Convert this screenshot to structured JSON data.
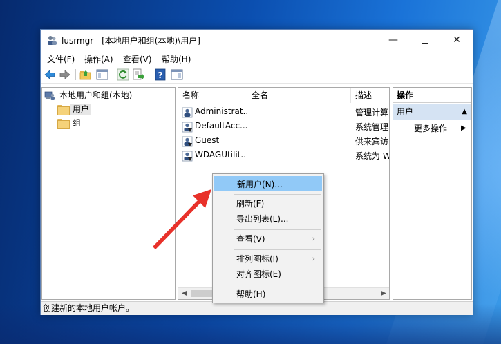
{
  "window": {
    "title": "lusrmgr - [本地用户和组(本地)\\用户]",
    "minimize_glyph": "—",
    "close_glyph": "✕"
  },
  "menubar": {
    "items": [
      "文件(F)",
      "操作(A)",
      "查看(V)",
      "帮助(H)"
    ]
  },
  "toolbar": {
    "icons": [
      "back-arrow-icon",
      "forward-arrow-icon",
      "up-folder-icon",
      "show-hide-tree-icon",
      "refresh-icon",
      "export-list-icon",
      "help-icon",
      "show-hide-action-pane-icon"
    ]
  },
  "tree": {
    "root": "本地用户和组(本地)",
    "items": [
      "用户",
      "组"
    ],
    "selected": "用户"
  },
  "list": {
    "columns": [
      "名称",
      "全名",
      "描述"
    ],
    "rows": [
      {
        "name": "Administrat...",
        "fullname": "",
        "desc": "管理计算"
      },
      {
        "name": "DefaultAcc...",
        "fullname": "",
        "desc": "系统管理"
      },
      {
        "name": "Guest",
        "fullname": "",
        "desc": "供来宾访"
      },
      {
        "name": "WDAGUtilit...",
        "fullname": "",
        "desc": "系统为 W"
      }
    ]
  },
  "actions": {
    "header": "操作",
    "section": "用户",
    "item": "更多操作"
  },
  "status": {
    "text": "创建新的本地用户帐户。"
  },
  "context_menu": {
    "items": [
      "新用户(N)...",
      "刷新(F)",
      "导出列表(L)...",
      "查看(V)",
      "排列图标(I)",
      "对齐图标(E)",
      "帮助(H)"
    ],
    "highlighted": "新用户(N)..."
  },
  "colors": {
    "accent_arrow": "#e8312a",
    "menu_highlight": "#91c9f7",
    "action_section": "#d5e3f3"
  }
}
